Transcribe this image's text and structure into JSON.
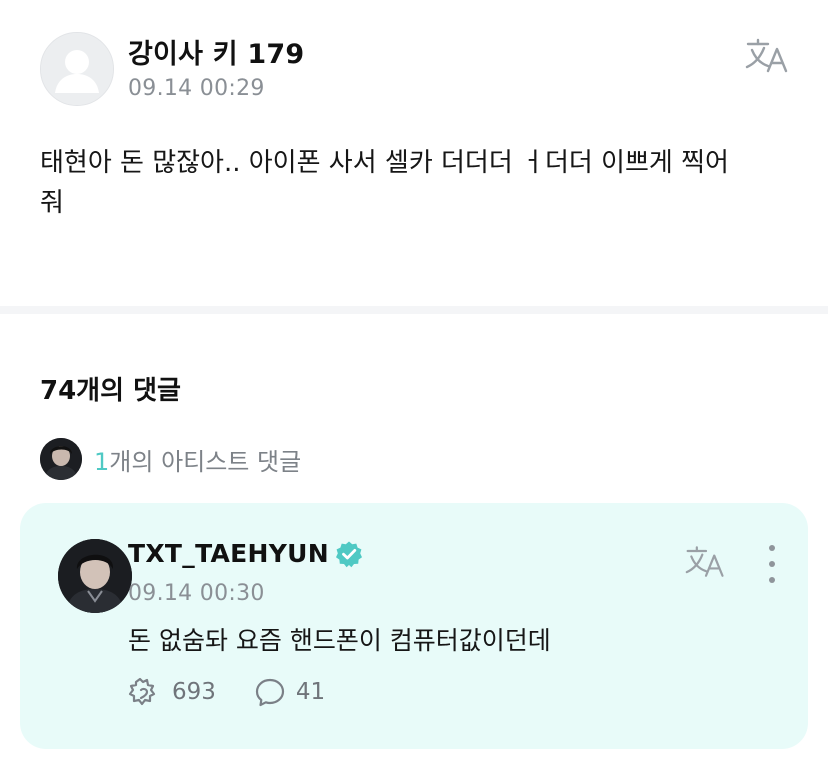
{
  "post": {
    "author": "강이사 키 179",
    "time": "09.14 00:29",
    "body": "태현아 돈 많잖아.. 아이폰 사서 셀카 더더더 ㅓ더더 이쁘게 찍어\n줘"
  },
  "comments": {
    "count_label": "74개의 댓글",
    "artist_summary": {
      "count": "1",
      "label": "개의 아티스트 댓글"
    },
    "artist_comment": {
      "author": "TXT_TAEHYUN",
      "time": "09.14 00:30",
      "text": "돈 없숨돠 요즘 핸드폰이 컴퓨터값이던데",
      "likes": "693",
      "replies": "41"
    }
  },
  "colors": {
    "accent": "#4fc9c4",
    "card_bg": "#e8fbf9",
    "muted_text": "#8a8f95"
  }
}
